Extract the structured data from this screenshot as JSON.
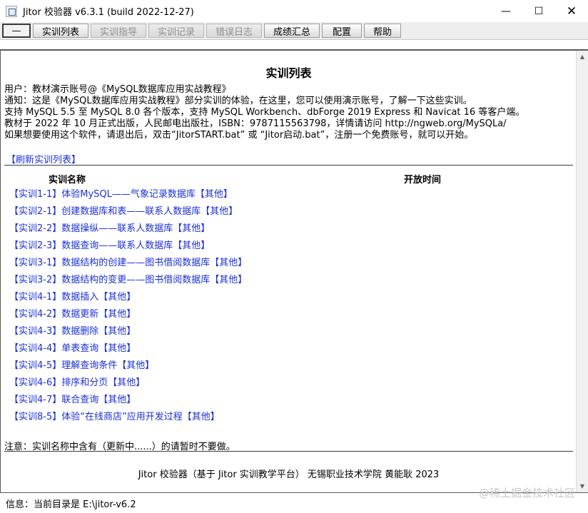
{
  "window": {
    "title": "Jitor 校验器 v6.3.1 (build 2022-12-27)",
    "minimize": "—",
    "maximize": "☐",
    "close": "✕"
  },
  "toolbar": {
    "dash": "—",
    "items": [
      {
        "label": "实训列表",
        "enabled": true
      },
      {
        "label": "实训指导",
        "enabled": false
      },
      {
        "label": "实训记录",
        "enabled": false
      },
      {
        "label": "错误日志",
        "enabled": false
      },
      {
        "label": "成绩汇总",
        "enabled": true
      },
      {
        "label": "配置",
        "enabled": true
      },
      {
        "label": "帮助",
        "enabled": true
      }
    ]
  },
  "main": {
    "title": "实训列表",
    "intro": [
      "用户：教材演示账号@《MySQL数据库应用实战教程》",
      "通知：这是《MySQL数据库应用实战教程》部分实训的体验，在这里，您可以使用演示账号，了解一下这些实训。",
      "支持 MySQL 5.5 至 MySQL 8.0 各个版本，支持 MySQL Workbench、dbForge 2019 Express 和 Navicat 16 等客户端。",
      "教材于 2022 年 10 月正式出版，人民邮电出版社，ISBN：9787115563798，详情请访问 http://ngweb.org/MySQLa/",
      "如果想要使用这个软件，请退出后，双击“JitorSTART.bat” 或 “Jitor启动.bat”，注册一个免费账号，就可以开始。"
    ],
    "refresh": "【刷新实训列表】",
    "col_name": "实训名称",
    "col_time": "开放时间",
    "trainings": [
      "【实训1-1】体验MySQL——气象记录数据库【其他】",
      "【实训2-1】创建数据库和表——联系人数据库【其他】",
      "【实训2-2】数据操纵——联系人数据库【其他】",
      "【实训2-3】数据查询——联系人数据库【其他】",
      "【实训3-1】数据结构的创建——图书借阅数据库【其他】",
      "【实训3-2】数据结构的变更——图书借阅数据库【其他】",
      "【实训4-1】数据插入【其他】",
      "【实训4-2】数据更新【其他】",
      "【实训4-3】数据删除【其他】",
      "【实训4-4】单表查询【其他】",
      "【实训4-5】理解查询条件【其他】",
      "【实训4-6】排序和分页【其他】",
      "【实训4-7】联合查询【其他】",
      "【实训8-5】体验“在线商店”应用开发过程【其他】"
    ],
    "note": "注意：实训名称中含有（更新中......）的请暂时不要做。",
    "footer": "Jitor 校验器（基于 Jitor 实训教学平台） 无锡职业技术学院 黄能耿 2023"
  },
  "status": {
    "text": "信息：当前目录是 E:\\jitor-v6.2"
  },
  "watermark": "@稀土掘金技术社区",
  "colors": {
    "link": "#1a2fd6",
    "toolbar_bg": "#eeeeee"
  }
}
